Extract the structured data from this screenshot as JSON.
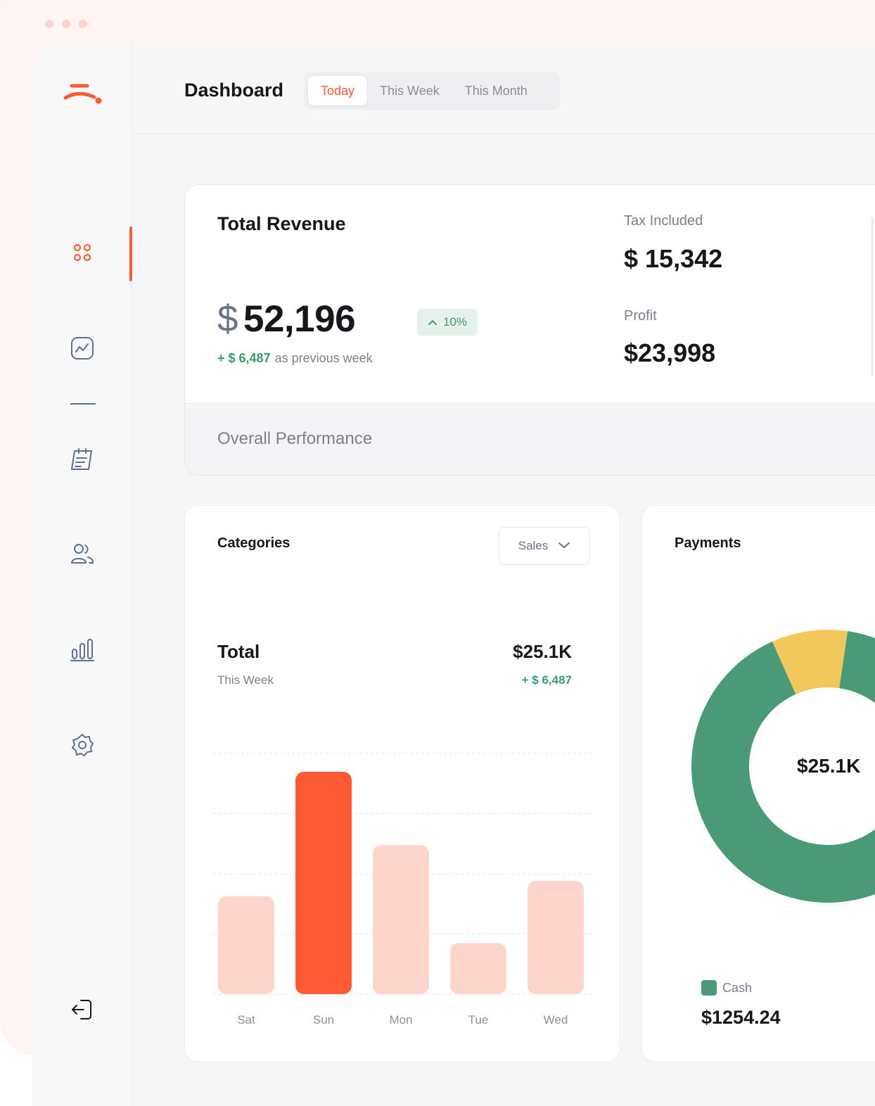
{
  "colors": {
    "accent": "#ff5a36",
    "accent_light": "#fdd5cc",
    "green": "#4a9a78",
    "yellow": "#f2c75b",
    "muted_text": "#7b808b"
  },
  "sidebar": {
    "logo_icon": "brand-logo-icon",
    "items": [
      {
        "icon": "dashboard-grid-icon",
        "active": true
      },
      {
        "icon": "analytics-chart-icon",
        "active": false
      },
      {
        "icon": "calendar-notes-icon",
        "active": false
      },
      {
        "icon": "users-icon",
        "active": false
      },
      {
        "icon": "bar-chart-icon",
        "active": false
      },
      {
        "icon": "gear-icon",
        "active": false
      }
    ],
    "logout_icon": "logout-icon"
  },
  "header": {
    "title": "Dashboard",
    "tabs": [
      {
        "label": "Today",
        "active": true
      },
      {
        "label": "This Week",
        "active": false
      },
      {
        "label": "This Month",
        "active": false
      }
    ]
  },
  "revenue": {
    "title": "Total Revenue",
    "currency": "$",
    "amount": "52,196",
    "badge": "10%",
    "delta": "+ $ 6,487",
    "delta_suffix": "as previous week",
    "tax_label": "Tax Included",
    "tax_value": "$ 15,342",
    "profit_label": "Profit",
    "profit_value": "$23,998",
    "performance_label": "Overall Performance"
  },
  "categories": {
    "title": "Categories",
    "select_value": "Sales",
    "total_label": "Total",
    "total_sub": "This Week",
    "total_value": "$25.1K",
    "total_delta": "+ $ 6,487"
  },
  "chart_data": {
    "type": "bar",
    "categories": [
      "Sat",
      "Sun",
      "Mon",
      "Tue",
      "Wed"
    ],
    "values": [
      44,
      100,
      67,
      23,
      51
    ],
    "highlight": "Sun",
    "ylim": [
      0,
      100
    ],
    "grid": true,
    "title": "",
    "xlabel": "",
    "ylabel": ""
  },
  "payments": {
    "title": "Payments",
    "center_value": "$25.1K",
    "segments": [
      {
        "name": "Cash",
        "fraction": 0.91,
        "color": "#4a9a78"
      },
      {
        "name": "",
        "fraction": 0.09,
        "color": "#f2c75b"
      }
    ],
    "legend": [
      {
        "label": "Cash",
        "value": "$1254.24"
      }
    ]
  }
}
